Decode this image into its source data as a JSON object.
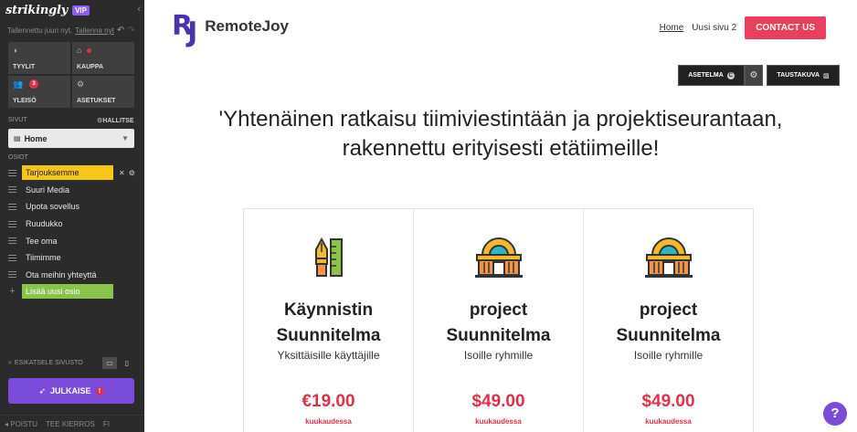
{
  "editor": {
    "brand": "strikingly",
    "badge": "VIP",
    "save_status": "Tallennettu juuri nyt.",
    "save_now": "Tallenna nyt",
    "tiles": [
      {
        "label": "TYYLIT",
        "icon": "palette-icon"
      },
      {
        "label": "KAUPPA",
        "icon": "shop-icon"
      },
      {
        "label": "YLEISÖ",
        "icon": "audience-icon",
        "count": "3"
      },
      {
        "label": "ASETUKSET",
        "icon": "gear-icon"
      }
    ],
    "pages_label": "SIVUT",
    "manage_label": "HALLITSE",
    "current_page": "Home",
    "sections_label": "OSIOT",
    "sections": [
      "Tarjouksemme",
      "Suuri Media",
      "Upota sovellus",
      "Ruudukko",
      "Tee oma",
      "Tiimimme",
      "Ota meihin yhteyttä"
    ],
    "add_section": "Lisää uusi osio",
    "preview_label": "ESIKATSELE SIVUSTO",
    "publish_label": "JULKAISE",
    "footer": [
      "POISTU",
      "TEE KIERROS",
      "FI"
    ],
    "colors": {
      "sidebar_bg": "#2b2b2b",
      "active_section": "#f5c518",
      "add_section": "#8bc34a",
      "publish": "#7b4cd9",
      "alert": "#e0314b"
    }
  },
  "site": {
    "logo_mark": "RJ",
    "logo_mark_r": "R",
    "logo_mark_j": "J",
    "logo_text": "RemoteJoy",
    "nav": [
      "Home",
      "Uusi sivu 2"
    ],
    "cta": "CONTACT US",
    "toolbar": {
      "layout": "ASETELMA",
      "layout_badge": "C",
      "background": "TAUSTAKUVA"
    },
    "headline_line1": "'Yhtenäinen ratkaisu tiimiviestintään ja projektiseurantaan,",
    "headline_line2": "rakennettu erityisesti etätiimeille!",
    "plans": [
      {
        "name_line1": "Käynnistin",
        "name_line2": "Suunnitelma",
        "desc": "Yksittäisille käyttäjille",
        "price": "€19.00",
        "period": "kuukaudessa",
        "icon": "pen-ruler-icon"
      },
      {
        "name_line1": "project",
        "name_line2": "Suunnitelma",
        "desc": "Isoille ryhmille",
        "price": "$49.00",
        "period": "kuukaudessa",
        "icon": "building-dome-icon"
      },
      {
        "name_line1": "project",
        "name_line2": "Suunnitelma",
        "desc": "Isoille ryhmille",
        "price": "$49.00",
        "period": "kuukaudessa",
        "icon": "building-dome-icon"
      }
    ],
    "help": "?",
    "colors": {
      "brand": "#4b33a8",
      "cta": "#e8405a",
      "price": "#e0314b"
    }
  }
}
